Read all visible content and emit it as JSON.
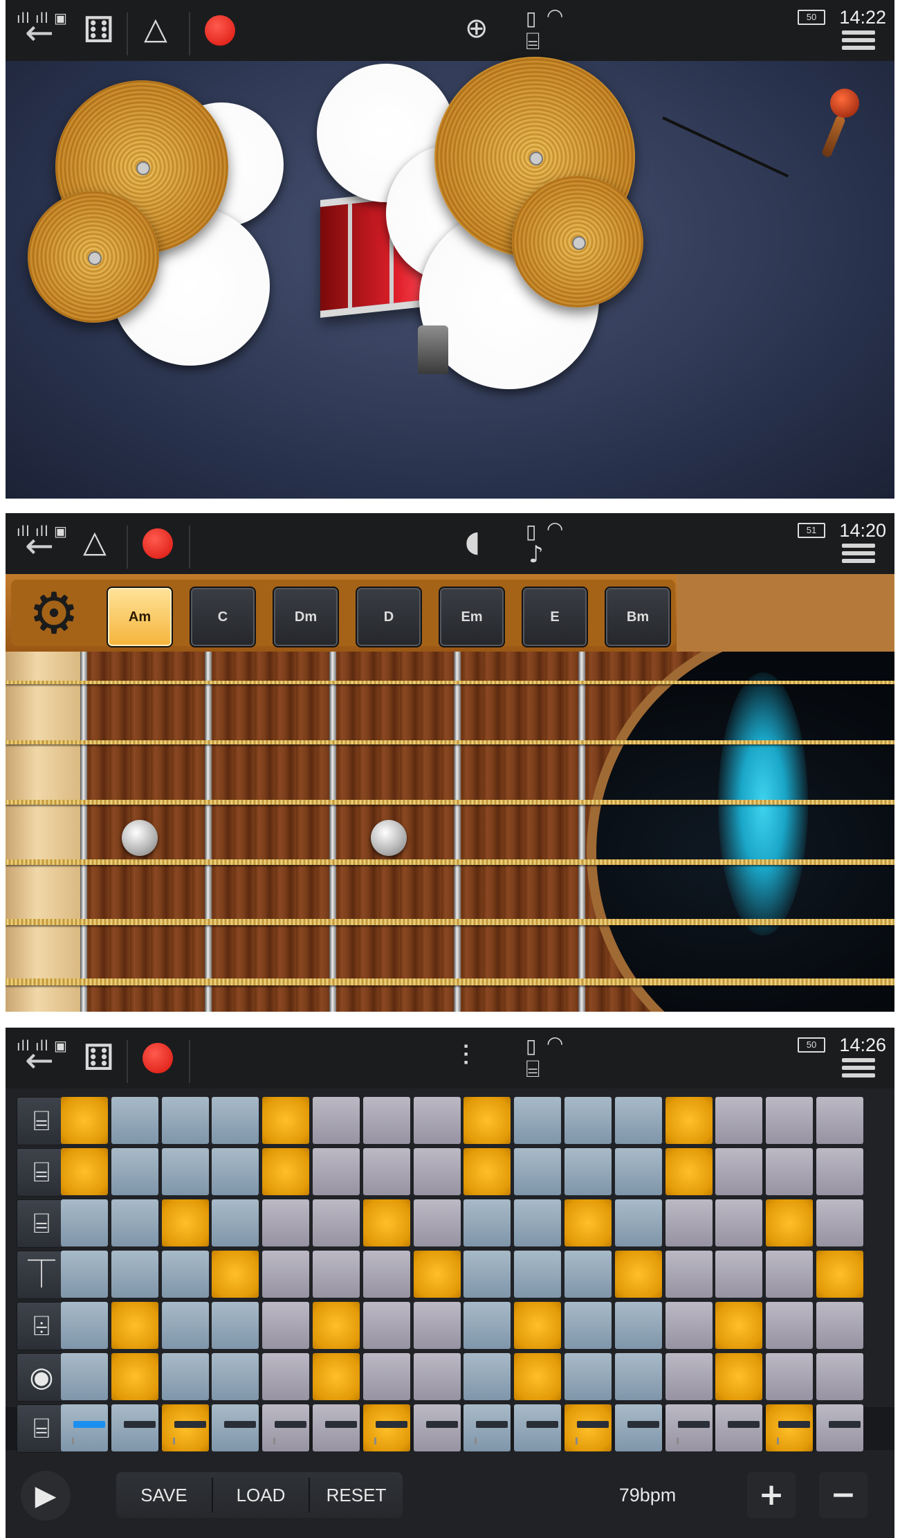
{
  "shot_drums": {
    "status": {
      "signal": "▂▄▆█₁▂▄▆█₂",
      "battery": "50",
      "time": "14:22"
    },
    "toolbar": {
      "back_icon": "back-arrow-icon",
      "dice_icon": "dice-icon",
      "metronome_icon": "metronome-icon",
      "record_icon": "record-icon",
      "kit_icon": "drum-kit-icon",
      "menu_icon": "menu-icon"
    }
  },
  "shot_guitar": {
    "status": {
      "signal": "▂▄▆█₁▂▄▆█₂",
      "battery": "51",
      "time": "14:20"
    },
    "chords": [
      {
        "label": "Am",
        "active": true
      },
      {
        "label": "C",
        "active": false
      },
      {
        "label": "Dm",
        "active": false
      },
      {
        "label": "D",
        "active": false
      },
      {
        "label": "Em",
        "active": false
      },
      {
        "label": "E",
        "active": false
      },
      {
        "label": "Bm",
        "active": false
      }
    ]
  },
  "shot_sequencer": {
    "status": {
      "signal": "▂▄▆█₁▂▄▆█₂",
      "battery": "50",
      "time": "14:26"
    },
    "instruments": [
      "drum-icon",
      "drum-icon",
      "drum-icon",
      "cymbal-icon",
      "snare-icon",
      "kick-icon",
      "drum-icon"
    ],
    "grid": [
      [
        1,
        0,
        0,
        0,
        1,
        0,
        0,
        0,
        1,
        0,
        0,
        0,
        1,
        0,
        0,
        0
      ],
      [
        1,
        0,
        0,
        0,
        1,
        0,
        0,
        0,
        1,
        0,
        0,
        0,
        1,
        0,
        0,
        0
      ],
      [
        0,
        0,
        1,
        0,
        0,
        0,
        1,
        0,
        0,
        0,
        1,
        0,
        0,
        0,
        1,
        0
      ],
      [
        0,
        0,
        0,
        1,
        0,
        0,
        0,
        1,
        0,
        0,
        0,
        1,
        0,
        0,
        0,
        1
      ],
      [
        0,
        1,
        0,
        0,
        0,
        1,
        0,
        0,
        0,
        1,
        0,
        0,
        0,
        1,
        0,
        0
      ],
      [
        0,
        1,
        0,
        0,
        0,
        1,
        0,
        0,
        0,
        1,
        0,
        0,
        0,
        1,
        0,
        0
      ],
      [
        0,
        0,
        1,
        0,
        0,
        0,
        1,
        0,
        0,
        0,
        1,
        0,
        0,
        0,
        1,
        0
      ]
    ],
    "current_step": "1",
    "buttons": {
      "save": "SAVE",
      "load": "LOAD",
      "reset": "RESET"
    },
    "tempo": "79bpm",
    "plus": "+",
    "minus": "−"
  }
}
